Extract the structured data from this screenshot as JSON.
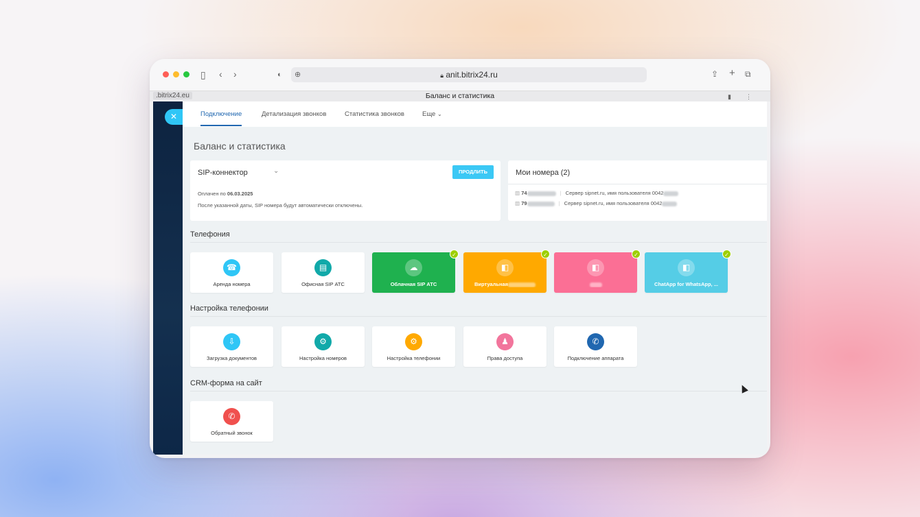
{
  "browser": {
    "url": "anit.bitrix24.ru",
    "tab_host": ".bitrix24.eu",
    "tab_title": "Баланс и статистика"
  },
  "nav": {
    "tabs": [
      "Подключение",
      "Детализация звонков",
      "Статистика звонков",
      "Еще"
    ]
  },
  "page_title": "Баланс и статистика",
  "sip": {
    "title": "SIP-коннектор",
    "button": "ПРОДЛИТЬ",
    "paid_label": "Оплачен по",
    "paid_date": "06.03.2025",
    "note": "После указанной даты, SIP номера будут автоматически отключены."
  },
  "numbers": {
    "title": "Мои номера (2)",
    "rows": [
      {
        "prefix": "74",
        "server": "Сервер sipnet.ru, имя пользователя 0042"
      },
      {
        "prefix": "79",
        "server": "Сервер sipnet.ru, имя пользователя 0042"
      }
    ]
  },
  "sections": {
    "telephony": {
      "title": "Телефония",
      "tiles": [
        {
          "label": "Аренда номера",
          "icon": "phone-rent-icon",
          "color": "#2fc6f6",
          "checked": false
        },
        {
          "label": "Офисная SIP АТС",
          "icon": "office-pbx-icon",
          "color": "#11a9a9",
          "checked": false
        },
        {
          "label": "Облачная SIP АТС",
          "icon": "cloud-pbx-icon",
          "color": "#1fb14f",
          "checked": true
        },
        {
          "label": "Виртуальная",
          "icon": "box-icon",
          "color": "#ffa900",
          "checked": true
        },
        {
          "label": "",
          "icon": "box-icon",
          "color": "#fb6f95",
          "checked": true
        },
        {
          "label": "ChatApp for WhatsApp, ...",
          "icon": "box-icon",
          "color": "#55cde6",
          "checked": true
        }
      ]
    },
    "settings": {
      "title": "Настройка телефонии",
      "tiles": [
        {
          "label": "Загрузка документов",
          "icon": "document-upload-icon",
          "color": "#2fc6f6"
        },
        {
          "label": "Настройка номеров",
          "icon": "number-settings-icon",
          "color": "#11a9a9"
        },
        {
          "label": "Настройка телефонии",
          "icon": "telephony-settings-icon",
          "color": "#ffa900"
        },
        {
          "label": "Права доступа",
          "icon": "access-rights-icon",
          "color": "#f2759c"
        },
        {
          "label": "Подключение аппарата",
          "icon": "device-connect-icon",
          "color": "#2067b0"
        }
      ]
    },
    "crm": {
      "title": "CRM-форма на сайт",
      "tiles": [
        {
          "label": "Обратный звонок",
          "icon": "callback-icon",
          "color": "#f0504e"
        }
      ]
    }
  }
}
